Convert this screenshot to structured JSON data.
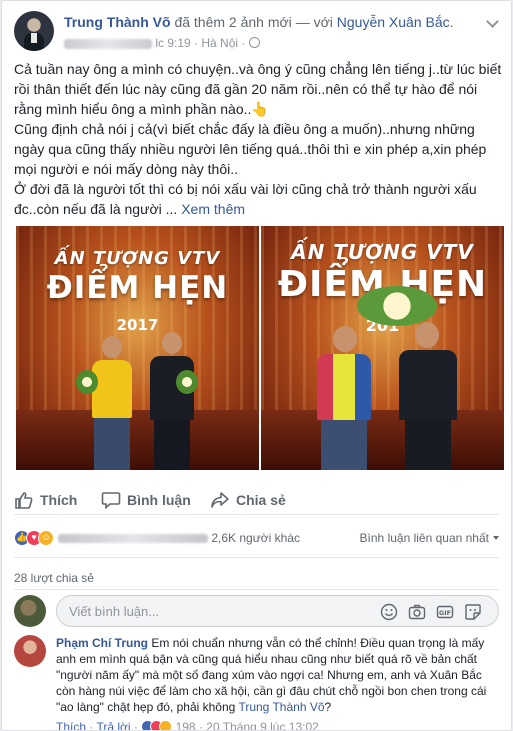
{
  "header": {
    "author": "Trung Thành Võ",
    "action": "đã thêm 2 ảnh mới",
    "with_prefix": "— với",
    "tagged": "Nguyễn Xuân Bắc",
    "suffix": ".",
    "time": "lc 9:19",
    "location": "Hà Nội"
  },
  "post": {
    "lines": [
      "Cả tuần nay ông a mình có chuyện..và ông ý cũng chẳng lên tiếng j..từ lúc biết rồi thân thiết đến lúc này cũng đã gần 20 năm rồi..nên có thể tự hào để nói rằng mình hiểu ông a mình phần nào..👆",
      "Cũng định chả nói j cả(vì biết chắc đấy là điều ông a muốn)..nhưng những ngày qua cũng thấy nhiều người lên tiếng quá..thôi thì e xin phép a,xin phép mọi người e nói mấy dòng này thôi..",
      "Ở đời đã là người tốt thì có bị nói xấu vài lời cũng chả trở thành người xấu đc..còn nếu đã là người ..."
    ],
    "see_more": "Xem thêm"
  },
  "photos": [
    {
      "line1": "ẤN TƯỢNG VTV",
      "line2": "ĐIỂM HẸN",
      "line3": "2017"
    },
    {
      "line1": "ẤN TƯỢNG VTV",
      "line2": "ĐIỂM HẸN",
      "line3": "201"
    }
  ],
  "actions": {
    "like": "Thích",
    "comment": "Bình luận",
    "share": "Chia sẻ"
  },
  "reactions": {
    "others": "2,6K người khác",
    "sort": "Bình luận liên quan nhất"
  },
  "shares": "28 lượt chia sẻ",
  "composer": {
    "placeholder": "Viết bình luận..."
  },
  "comment": {
    "author": "Phạm Chí Trung",
    "text": "Em nói chuẩn nhưng vẫn có thể chỉnh! Điều quan trọng là mấy anh em mình quá bận và cũng quá hiểu nhau cũng như biết quá rõ về bản chất \"người năm ấy\" mà một số đang xúm vào ngợi ca! Nhưng em, anh và Xuân Bắc còn hàng núi việc để làm cho xã hội, cần gì đâu chút chỗ ngồi bon chen trong cái \"ao làng\" chật hẹp đó, phải không",
    "mention": "Trung Thành Võ",
    "end": "?",
    "like": "Thích",
    "reply": "Trả lời",
    "count": "198",
    "date": "20 Tháng 9 lúc 13:02"
  },
  "colors": {
    "link": "#365899",
    "like": "#4267b2",
    "love": "#f33e58",
    "haha": "#f7b125"
  }
}
